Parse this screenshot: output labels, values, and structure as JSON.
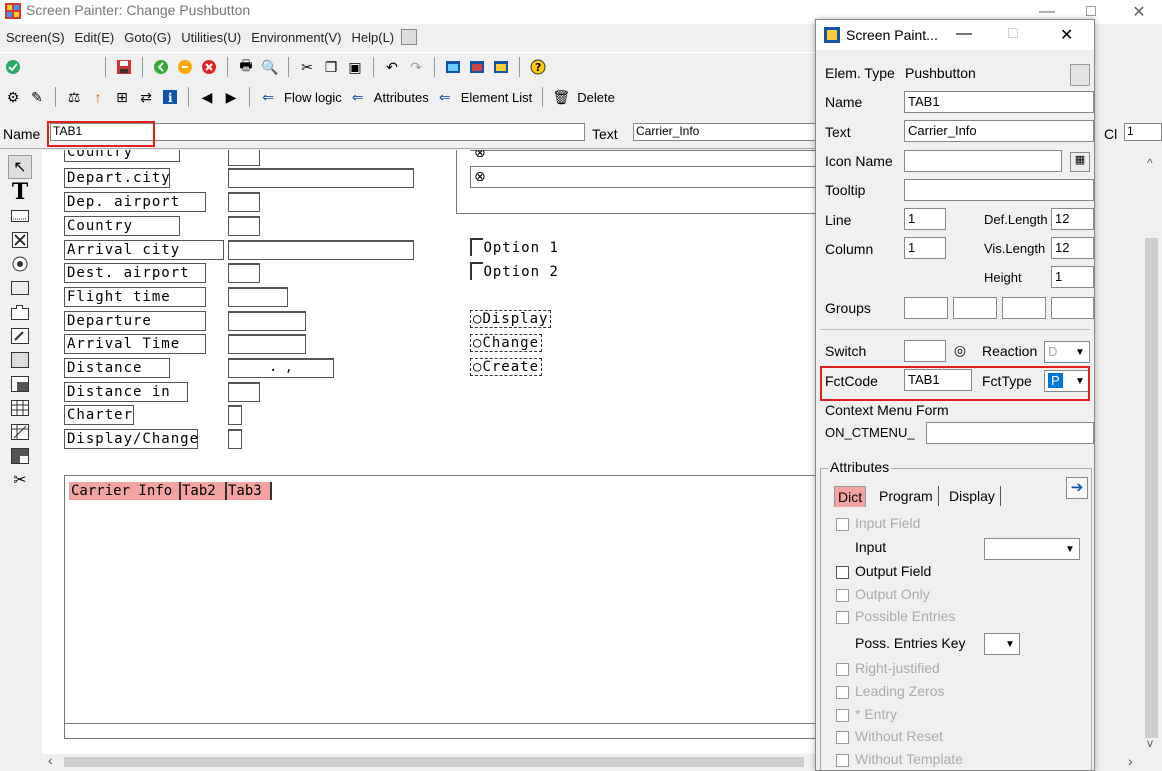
{
  "window": {
    "title": "Screen Painter: Change Pushbutton",
    "minimize": "—",
    "maximize": "□",
    "close": "✕"
  },
  "menu": [
    "Screen(S)",
    "Edit(E)",
    "Goto(G)",
    "Utilities(U)",
    "Environment(V)",
    "Help(L)"
  ],
  "toolbar2": {
    "flow_logic": "Flow logic",
    "attributes": "Attributes",
    "element_list": "Element List",
    "delete": "Delete"
  },
  "name_row": {
    "name_label": "Name",
    "name_value": "TAB1",
    "text_label": "Text",
    "text_value": "Carrier_Info",
    "cl_label": "Cl",
    "cl_value": "1"
  },
  "canvas": {
    "labels": [
      "Country",
      "Depart.city",
      "Dep. airport",
      "Country",
      "Arrival city",
      "Dest. airport",
      "Flight time",
      "Departure",
      "Arrival Time",
      "Distance",
      "Distance in",
      "Charter",
      "Display/Change"
    ],
    "distance_value": ".   ,",
    "checkboxes": [
      "Option 1",
      "Option 2"
    ],
    "radios": [
      "Display",
      "Change",
      "Create"
    ],
    "tabs": [
      "Carrier Info",
      "Tab2",
      "Tab3"
    ]
  },
  "dialog": {
    "title": "Screen Paint...",
    "elem_type_label": "Elem. Type",
    "elem_type_value": "Pushbutton",
    "name_label": "Name",
    "name_value": "TAB1",
    "text_label": "Text",
    "text_value": "Carrier_Info",
    "icon_name_label": "Icon Name",
    "icon_name_value": "",
    "tooltip_label": "Tooltip",
    "tooltip_value": "",
    "line_label": "Line",
    "line_value": "1",
    "def_length_label": "Def.Length",
    "def_length_value": "12",
    "column_label": "Column",
    "column_value": "1",
    "vis_length_label": "Vis.Length",
    "vis_length_value": "12",
    "height_label": "Height",
    "height_value": "1",
    "groups_label": "Groups",
    "switch_label": "Switch",
    "reaction_label": "Reaction",
    "reaction_value": "D",
    "fctcode_label": "FctCode",
    "fctcode_value": "TAB1",
    "fcttype_label": "FctType",
    "fcttype_value": "P",
    "context_menu_label": "Context Menu Form",
    "on_ctmenu_label": "ON_CTMENU_",
    "attributes_label": "Attributes",
    "tabs": [
      "Dict",
      "Program",
      "Display"
    ],
    "input_field": "Input Field",
    "input_label": "Input",
    "output_field": "Output Field",
    "output_only": "Output Only",
    "possible_entries": "Possible Entries",
    "poss_entries_key": "Poss. Entries Key",
    "right_justified": "Right-justified",
    "leading_zeros": "Leading Zeros",
    "star_entry": "* Entry",
    "without_reset": "Without Reset",
    "without_template": "Without Template"
  },
  "colors": {
    "highlight_red": "#e02020",
    "tab_pink": "#f4a3a3",
    "selected_blue": "#0078d7"
  }
}
